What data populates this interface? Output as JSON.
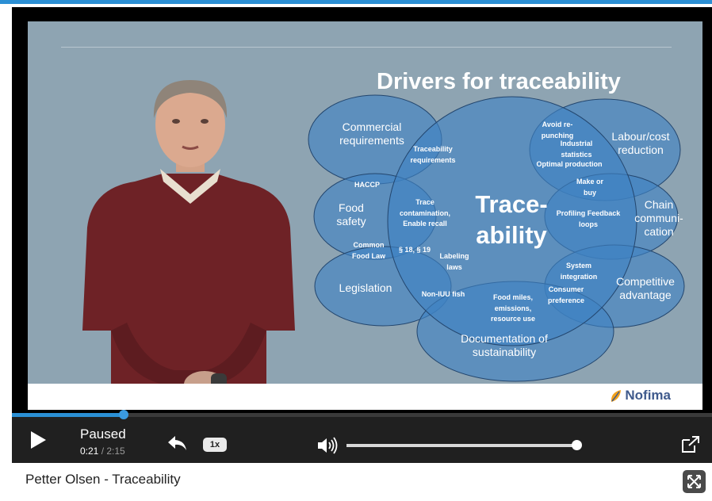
{
  "slide": {
    "title": "Drivers for traceability",
    "center": [
      "Trace-",
      "ability"
    ],
    "labels": {
      "commercial": "Commercial requirements",
      "labour": "Labour/cost reduction",
      "food_safety": "Food safety",
      "chain": "Chain communi- cation",
      "legislation": "Legislation",
      "competitive": "Competitive advantage",
      "documentation": "Documentation of sustainability",
      "traceability_req": "Traceability requirements",
      "avoid": "Avoid re- punching",
      "industrial": "Industrial statistics",
      "optimal": "Optimal production",
      "haccp": "HACCP",
      "trace_contam": "Trace contamination, Enable recall",
      "make_buy": "Make or buy",
      "profiling": "Profiling Feedback loops",
      "common_food_law": "Common Food Law",
      "par": "§ 18, § 19",
      "labeling": "Labeling laws",
      "system_integration": "System integration",
      "non_iuu": "Non-IUU fish",
      "food_miles": "Food miles, emissions, resource use",
      "consumer_pref": "Consumer preference"
    },
    "logo": "Nofima"
  },
  "player": {
    "status": "Paused",
    "current_time": "0:21",
    "separator": " / ",
    "duration": "2:15",
    "speed": "1x",
    "progress_fraction": 0.16,
    "volume_fraction": 0.98
  },
  "video_title": "Petter Olsen - Traceability",
  "colors": {
    "accent": "#2b8fd4",
    "slide_bg": "#8ea4b2",
    "ellipse_fill": "#3f82c4"
  }
}
